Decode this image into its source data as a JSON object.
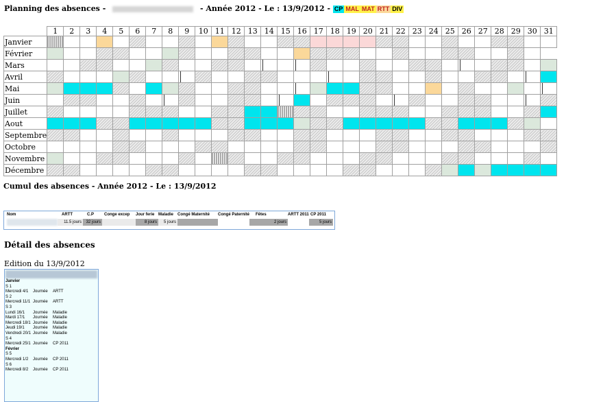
{
  "header": {
    "prefix": "Planning des absences -",
    "suffix": "- Année 2012 - Le : 13/9/2012 -",
    "legend": [
      {
        "label": "CP",
        "bg": "#00e5ee",
        "fg": "#000"
      },
      {
        "label": "MAL",
        "bg": "#fff24a",
        "fg": "#c02020"
      },
      {
        "label": "MAT",
        "bg": "#fff24a",
        "fg": "#c02020"
      },
      {
        "label": "RTT",
        "bg": "#fbd89a",
        "fg": "#c02020"
      },
      {
        "label": "DIV",
        "bg": "#fff24a",
        "fg": "#000"
      }
    ]
  },
  "calendar": {
    "days": [
      "1",
      "2",
      "3",
      "4",
      "5",
      "6",
      "7",
      "8",
      "9",
      "10",
      "11",
      "12",
      "13",
      "14",
      "15",
      "16",
      "17",
      "18",
      "19",
      "20",
      "21",
      "22",
      "23",
      "24",
      "25",
      "26",
      "27",
      "28",
      "29",
      "30",
      "31"
    ],
    "legend_codes": {
      "w": "empty",
      "s": "weekend",
      "g": "holiday",
      "p": "sick",
      "o": "rtt",
      "c": "cp",
      "v": "other",
      "h": "half-day",
      "x": "no-day"
    },
    "months": [
      {
        "name": "Janvier",
        "cells": "vwwowswwswoswwssppppsswwswwsswwww"
      },
      {
        "name": "Février",
        "cells": "gwwsswwgswwsswwossswwswwsswwswxx"
      },
      {
        "name": "Mars",
        "cells": "wwsswwgswwsswhwhswwswwsswhwsswgs"
      },
      {
        "name": "Avril",
        "cells": "swwwgswwhswwsswwwhwsswwswwsswhcx"
      },
      {
        "name": "Mai",
        "cells": "gcccswcgswwsswwhgccsswwowswwgwhw"
      },
      {
        "name": "Juin",
        "cells": "wsswwswhswwsswhcwssswhswwsswwhswx"
      },
      {
        "name": "Juillet",
        "cells": "swwwwssswwssccvsswwssswwssswwsccc"
      },
      {
        "name": "Aout",
        "cells": "cccsscccccsscccgsscccccsscccsgwww"
      },
      {
        "name": "Septembre",
        "cells": "sswwswwswwwsswwsswwwsswwsswwwsswx"
      },
      {
        "name": "Octobre",
        "cells": "wwwwsswwwsswwwwsswwwsswwwsswwwsw"
      },
      {
        "name": "Novembre",
        "cells": "gwwsswwwswvswwsswwwsswwwsswwwswx"
      },
      {
        "name": "Décembre",
        "cells": "sswwwwsswwwwsswwwwsswwwsgcgccccsc"
      }
    ]
  },
  "cumul": {
    "title": "Cumul des absences - Année 2012 - Le : 13/9/2012",
    "headers": [
      "Nom",
      "ARTT",
      "C.P",
      "Conge excep",
      "Jour ferie",
      "Maladie",
      "Congé Maternité",
      "Congé Paternité",
      "Fêtes",
      "ARTT 2011",
      "CP 2011"
    ],
    "values": {
      "artt": "11.5 jours",
      "cp": "32 jours",
      "jour_ferie": "8 jours",
      "maladie": "5 jours",
      "fetes": "2 jours",
      "cp2011": "5 jours"
    }
  },
  "detail": {
    "title": "Détail des absences",
    "edition": "Edition du 13/9/2012",
    "rows": [
      {
        "type": "month",
        "c1": "Janvier"
      },
      {
        "type": "week",
        "c1": "S 1"
      },
      {
        "type": "entry",
        "c1": "Mercredi 4/1",
        "c2": "Journée",
        "c3": "ARTT"
      },
      {
        "type": "week",
        "c1": "S 2"
      },
      {
        "type": "entry",
        "c1": "Mercredi 11/1",
        "c2": "Journée",
        "c3": "ARTT"
      },
      {
        "type": "week",
        "c1": "S 3"
      },
      {
        "type": "entry",
        "c1": "Lundi 16/1",
        "c2": "Journée",
        "c3": "Maladie"
      },
      {
        "type": "entry",
        "c1": "Mardi 17/1",
        "c2": "Journée",
        "c3": "Maladie"
      },
      {
        "type": "entry",
        "c1": "Mercredi 18/1",
        "c2": "Journée",
        "c3": "Maladie"
      },
      {
        "type": "entry",
        "c1": "Jeudi 19/1",
        "c2": "Journée",
        "c3": "Maladie"
      },
      {
        "type": "entry",
        "c1": "Vendredi 20/1",
        "c2": "Journée",
        "c3": "Maladie"
      },
      {
        "type": "week",
        "c1": "S 4"
      },
      {
        "type": "entry",
        "c1": "Mercredi 25/1",
        "c2": "Journée",
        "c3": "CP 2011"
      },
      {
        "type": "month",
        "c1": "Février"
      },
      {
        "type": "week",
        "c1": "S 5"
      },
      {
        "type": "entry",
        "c1": "Mercredi 1/2",
        "c2": "Journée",
        "c3": "CP 2011"
      },
      {
        "type": "week",
        "c1": "S 6"
      },
      {
        "type": "entry",
        "c1": "Mercredi 8/2",
        "c2": "Journée",
        "c3": "CP 2011"
      }
    ]
  }
}
